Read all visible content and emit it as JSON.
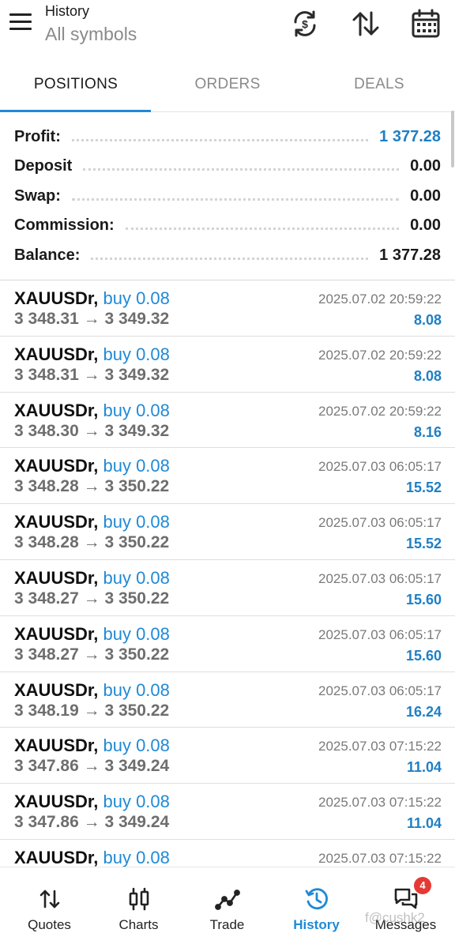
{
  "header": {
    "title": "History",
    "subtitle": "All symbols"
  },
  "tabs": [
    {
      "label": "POSITIONS",
      "active": true
    },
    {
      "label": "ORDERS",
      "active": false
    },
    {
      "label": "DEALS",
      "active": false
    }
  ],
  "summary": {
    "profit_label": "Profit:",
    "profit_value": "1 377.28",
    "deposit_label": "Deposit",
    "deposit_value": "0.00",
    "swap_label": "Swap:",
    "swap_value": "0.00",
    "commission_label": "Commission:",
    "commission_value": "0.00",
    "balance_label": "Balance:",
    "balance_value": "1 377.28"
  },
  "deals": [
    {
      "symbol": "XAUUSDr,",
      "type": "buy 0.08",
      "open": "3 348.31",
      "close": "3 349.32",
      "time": "2025.07.02 20:59:22",
      "profit": "8.08"
    },
    {
      "symbol": "XAUUSDr,",
      "type": "buy 0.08",
      "open": "3 348.31",
      "close": "3 349.32",
      "time": "2025.07.02 20:59:22",
      "profit": "8.08"
    },
    {
      "symbol": "XAUUSDr,",
      "type": "buy 0.08",
      "open": "3 348.30",
      "close": "3 349.32",
      "time": "2025.07.02 20:59:22",
      "profit": "8.16"
    },
    {
      "symbol": "XAUUSDr,",
      "type": "buy 0.08",
      "open": "3 348.28",
      "close": "3 350.22",
      "time": "2025.07.03 06:05:17",
      "profit": "15.52"
    },
    {
      "symbol": "XAUUSDr,",
      "type": "buy 0.08",
      "open": "3 348.28",
      "close": "3 350.22",
      "time": "2025.07.03 06:05:17",
      "profit": "15.52"
    },
    {
      "symbol": "XAUUSDr,",
      "type": "buy 0.08",
      "open": "3 348.27",
      "close": "3 350.22",
      "time": "2025.07.03 06:05:17",
      "profit": "15.60"
    },
    {
      "symbol": "XAUUSDr,",
      "type": "buy 0.08",
      "open": "3 348.27",
      "close": "3 350.22",
      "time": "2025.07.03 06:05:17",
      "profit": "15.60"
    },
    {
      "symbol": "XAUUSDr,",
      "type": "buy 0.08",
      "open": "3 348.19",
      "close": "3 350.22",
      "time": "2025.07.03 06:05:17",
      "profit": "16.24"
    },
    {
      "symbol": "XAUUSDr,",
      "type": "buy 0.08",
      "open": "3 347.86",
      "close": "3 349.24",
      "time": "2025.07.03 07:15:22",
      "profit": "11.04"
    },
    {
      "symbol": "XAUUSDr,",
      "type": "buy 0.08",
      "open": "3 347.86",
      "close": "3 349.24",
      "time": "2025.07.03 07:15:22",
      "profit": "11.04"
    },
    {
      "symbol": "XAUUSDr,",
      "type": "buy 0.08",
      "open": "",
      "close": "",
      "time": "2025.07.03 07:15:22",
      "profit": ""
    }
  ],
  "arrow": "→",
  "nav": [
    {
      "label": "Quotes",
      "icon": "quotes-icon",
      "active": false
    },
    {
      "label": "Charts",
      "icon": "charts-icon",
      "active": false
    },
    {
      "label": "Trade",
      "icon": "trade-icon",
      "active": false
    },
    {
      "label": "History",
      "icon": "history-icon",
      "active": true
    },
    {
      "label": "Messages",
      "icon": "messages-icon",
      "active": false,
      "badge": "4"
    }
  ],
  "watermark": "f@cushk2",
  "colors": {
    "accent": "#1f8ad6",
    "profit": "#1f7fc4",
    "badge": "#e53935"
  }
}
